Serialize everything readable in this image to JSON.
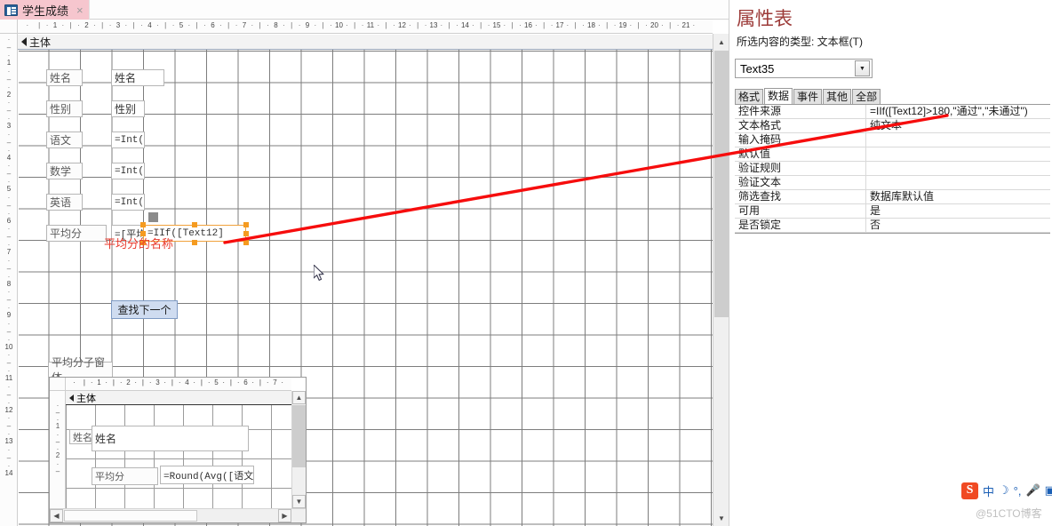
{
  "window": {
    "tab": {
      "label": "学生成绩",
      "icon": "form-icon",
      "close_icon": "×"
    }
  },
  "design_view": {
    "section_header": "主体",
    "hruler_numbers": [
      1,
      2,
      3,
      4,
      5,
      6,
      7,
      8,
      9,
      10,
      11,
      12,
      13,
      14,
      15,
      16,
      17,
      18,
      19,
      20,
      21
    ],
    "vruler_numbers": [
      1,
      2,
      3,
      4,
      5,
      6,
      7,
      8,
      9,
      10,
      11,
      12,
      13,
      14
    ],
    "controls": {
      "labels": [
        "姓名",
        "性别",
        "语文",
        "数学",
        "英语",
        "平均分"
      ],
      "textboxes": [
        "姓名",
        "性别",
        "=Int(",
        "=Int(",
        "=Int(",
        "=[平均分"
      ],
      "selected_textbox": "=IIf([Text12]",
      "button": "查找下一个"
    },
    "annotation": "平均分的名称",
    "annotation_color": "#e8372a"
  },
  "subform": {
    "label": "平均分子窗体",
    "section_header": "主体",
    "hruler_numbers": [
      1,
      2,
      3,
      4,
      5,
      6,
      7
    ],
    "vruler_numbers": [
      1,
      2
    ],
    "controls": {
      "label_name": "姓名",
      "textbox_name": "姓名",
      "label_avg": "平均分",
      "textbox_avg": "=Round(Avg([语文"
    }
  },
  "property_sheet": {
    "title": "属性表",
    "subtitle_prefix": "所选内容的类型: ",
    "subtitle_type": "文本框(T)",
    "selected_object": "Text35",
    "tabs": [
      {
        "label": "格式",
        "active": false
      },
      {
        "label": "数据",
        "active": true
      },
      {
        "label": "事件",
        "active": false
      },
      {
        "label": "其他",
        "active": false
      },
      {
        "label": "全部",
        "active": false
      }
    ],
    "rows": [
      {
        "name": "控件来源",
        "value": "=IIf([Text12]>180,\"通过\",\"未通过\")"
      },
      {
        "name": "文本格式",
        "value": "纯文本"
      },
      {
        "name": "输入掩码",
        "value": ""
      },
      {
        "name": "默认值",
        "value": ""
      },
      {
        "name": "验证规则",
        "value": ""
      },
      {
        "name": "验证文本",
        "value": ""
      },
      {
        "name": "筛选查找",
        "value": "数据库默认值"
      },
      {
        "name": "可用",
        "value": "是"
      },
      {
        "name": "是否锁定",
        "value": "否"
      }
    ],
    "title_color": "#9c3a38"
  },
  "ime_toolbar": {
    "logo": "S",
    "items": [
      "中",
      "☽",
      "°,",
      "🎤",
      "▣"
    ]
  },
  "watermark": "@51CTO博客"
}
